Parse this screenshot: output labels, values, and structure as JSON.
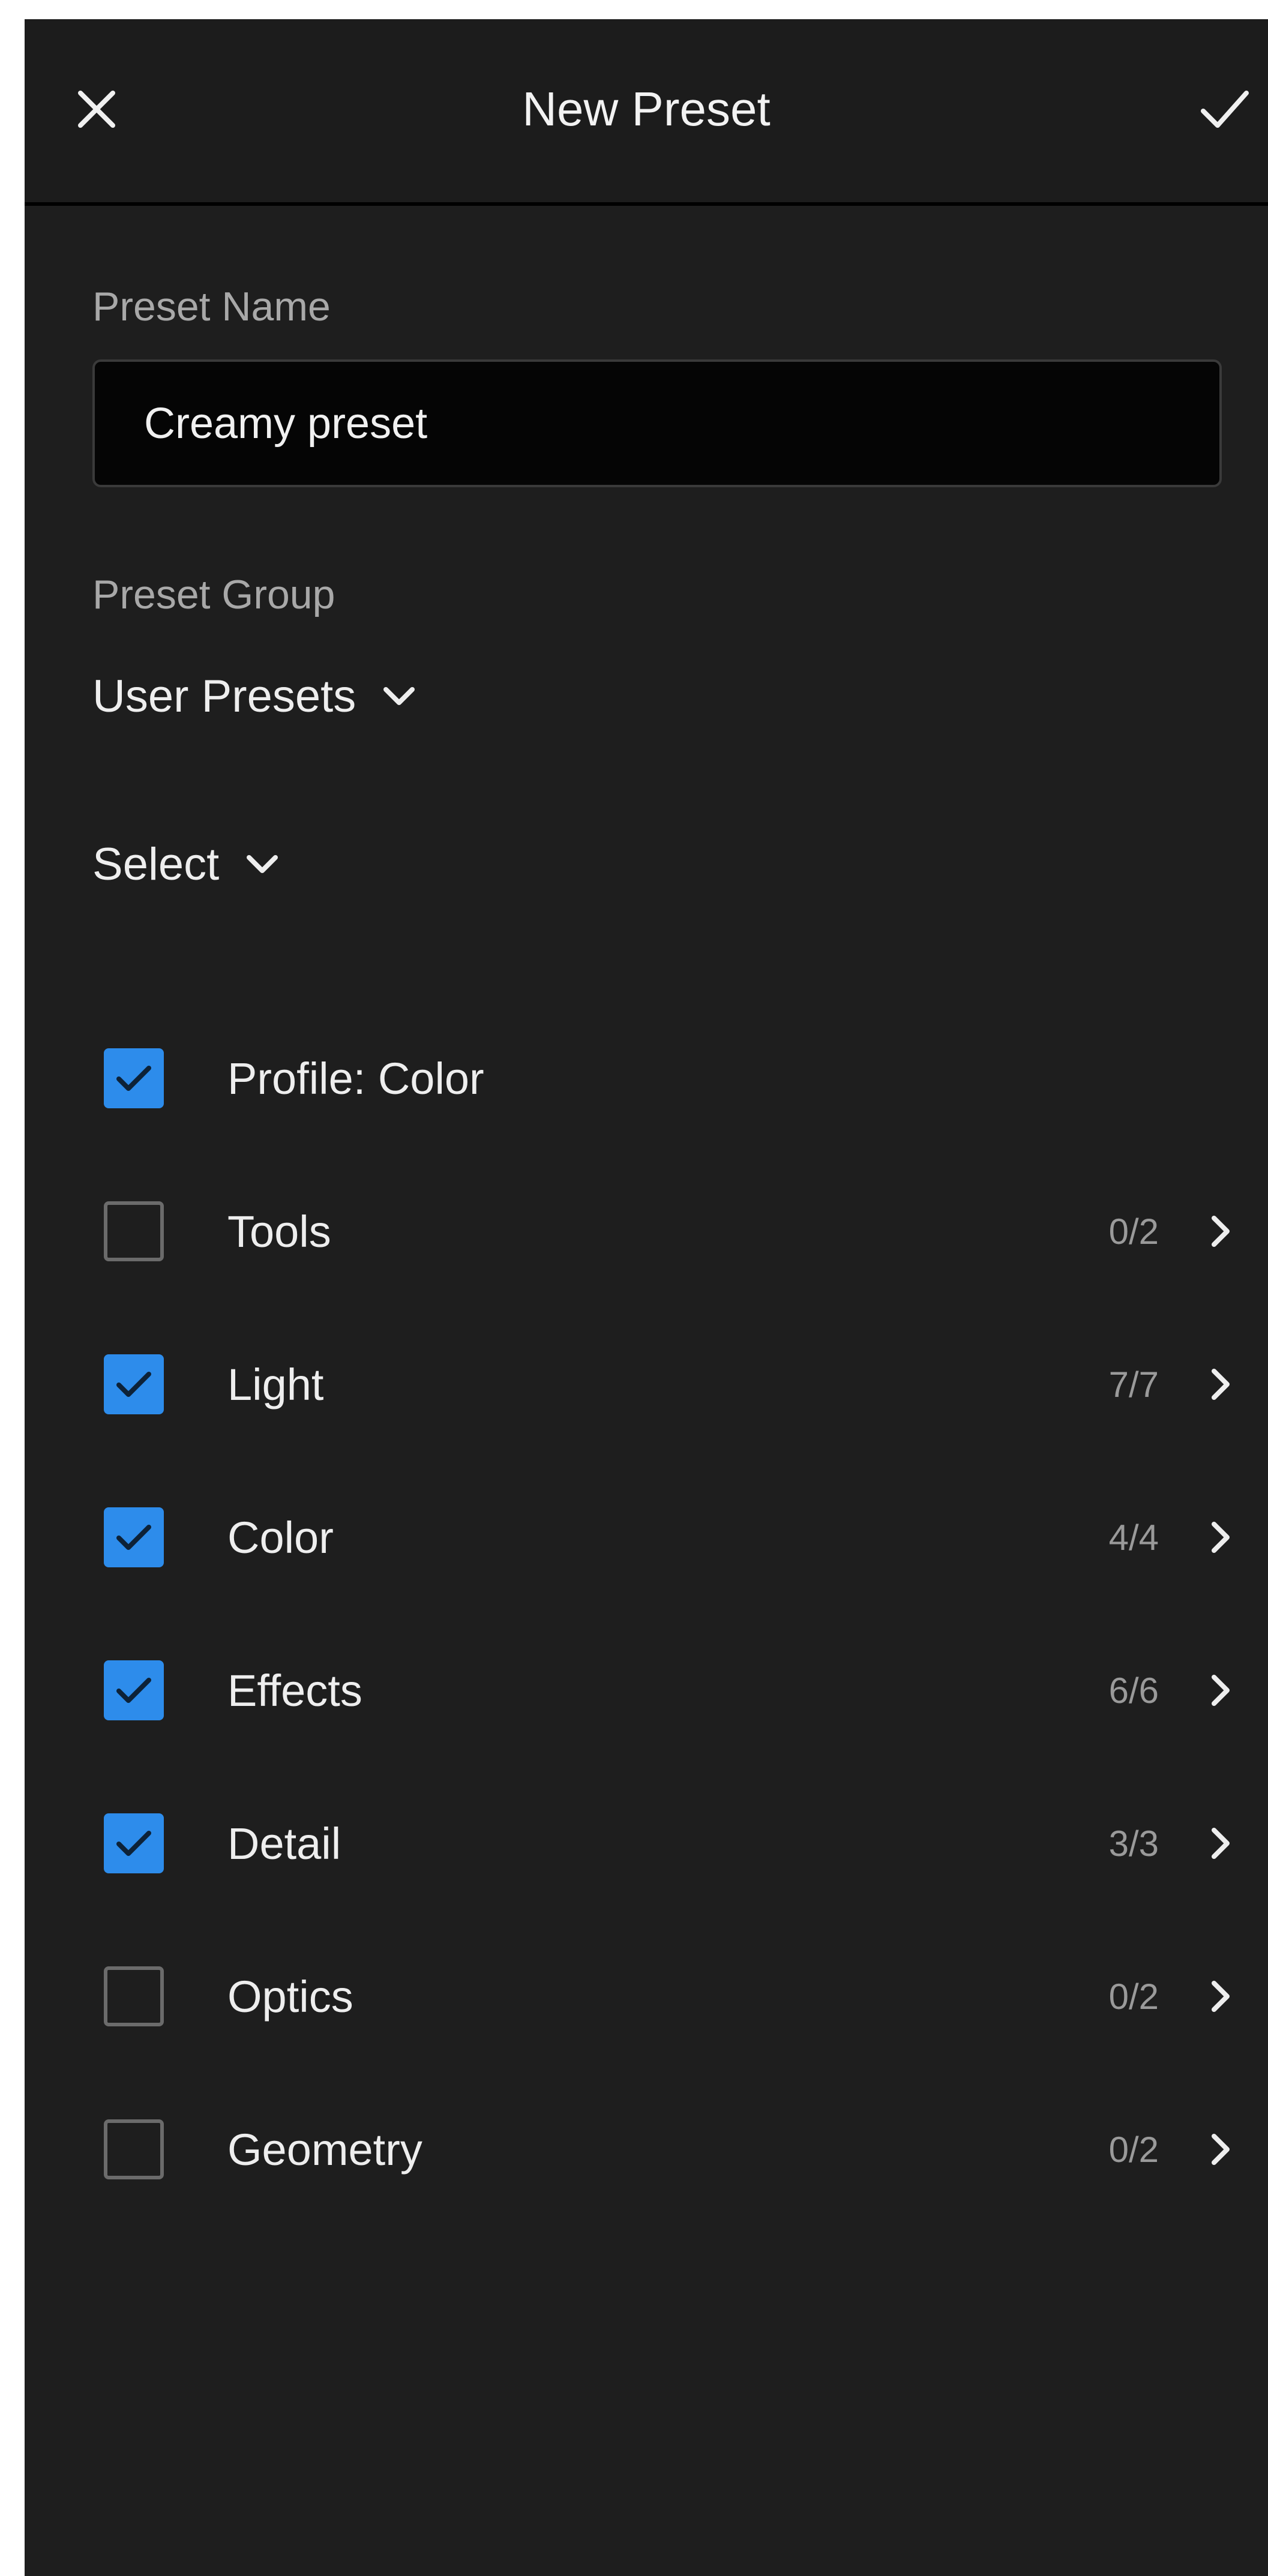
{
  "header": {
    "title": "New Preset",
    "close_icon": "close-icon",
    "confirm_icon": "checkmark-icon"
  },
  "preset_name": {
    "label": "Preset Name",
    "value": "Creamy preset"
  },
  "preset_group": {
    "label": "Preset Group",
    "selected": "User Presets"
  },
  "select_menu": {
    "label": "Select"
  },
  "settings": [
    {
      "label": "Profile: Color",
      "checked": true,
      "count": ""
    },
    {
      "label": "Tools",
      "checked": false,
      "count": "0/2"
    },
    {
      "label": "Light",
      "checked": true,
      "count": "7/7"
    },
    {
      "label": "Color",
      "checked": true,
      "count": "4/4"
    },
    {
      "label": "Effects",
      "checked": true,
      "count": "6/6"
    },
    {
      "label": "Detail",
      "checked": true,
      "count": "3/3"
    },
    {
      "label": "Optics",
      "checked": false,
      "count": "0/2"
    },
    {
      "label": "Geometry",
      "checked": false,
      "count": "0/2"
    }
  ],
  "colors": {
    "accent": "#2d8ceb",
    "background": "#1e1e1e",
    "input_background": "#050505"
  }
}
